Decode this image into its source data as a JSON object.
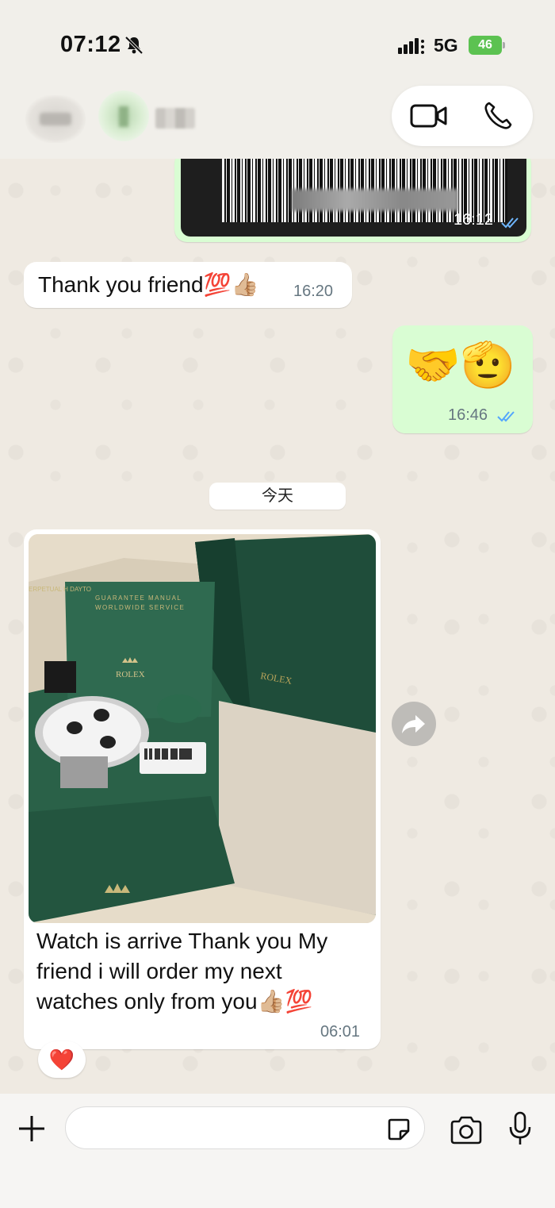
{
  "status_bar": {
    "time": "07:12",
    "network": "5G",
    "battery": "46"
  },
  "header": {
    "contact_name": "",
    "icons": [
      "back-icon",
      "avatar",
      "video-call-icon",
      "voice-call-icon"
    ]
  },
  "messages": [
    {
      "direction": "outgoing",
      "type": "image",
      "image": "barcode-label",
      "time": "16:12",
      "status": "read"
    },
    {
      "direction": "incoming",
      "type": "text",
      "text": "Thank you friend",
      "emoji": "💯👍🏼",
      "time": "16:20"
    },
    {
      "direction": "outgoing",
      "type": "emoji",
      "text": "🤝🫡",
      "time": "16:46",
      "status": "read"
    },
    {
      "direction": "incoming",
      "type": "image",
      "image": "rolex-box-photo",
      "caption": "Watch is arrive Thank you My friend i will order my next watches only from you",
      "caption_emoji": "👍🏼💯",
      "time": "06:01",
      "reaction": "❤️"
    }
  ],
  "date_divider": "今天",
  "photo_text": {
    "manual_line1": "GUARANTEE MANUAL",
    "manual_line2": "WORLDWIDE SERVICE",
    "brand": "ROLEX",
    "side": "ERPETUAL H DAYTO"
  },
  "composer": {
    "placeholder": "",
    "icons": [
      "plus-icon",
      "sticker-icon",
      "camera-icon",
      "microphone-icon"
    ]
  },
  "colors": {
    "incoming_bubble": "#ffffff",
    "outgoing_bubble": "#d9fdd3",
    "read_tick": "#53a6fd",
    "background": "#efeae2",
    "reaction_heart": "#e0262e"
  }
}
